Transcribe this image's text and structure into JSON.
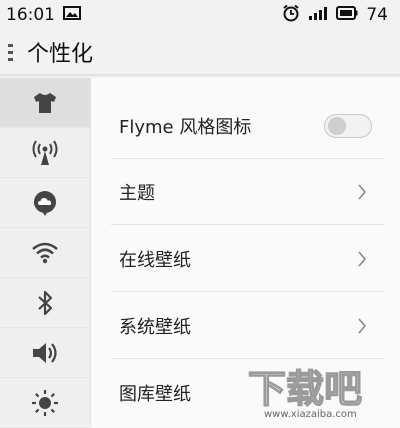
{
  "status_bar": {
    "time": "16:01",
    "battery": "74"
  },
  "app_bar": {
    "title": "个性化"
  },
  "sidebar": {
    "items": [
      {
        "icon": "tshirt-icon",
        "active": true
      },
      {
        "icon": "hotspot-icon",
        "active": false
      },
      {
        "icon": "cloud-icon",
        "active": false
      },
      {
        "icon": "wifi-icon",
        "active": false
      },
      {
        "icon": "bluetooth-icon",
        "active": false
      },
      {
        "icon": "volume-icon",
        "active": false
      },
      {
        "icon": "brightness-icon",
        "active": false
      }
    ]
  },
  "settings": {
    "flyme_icon_style": {
      "label": "Flyme 风格图标",
      "enabled": false
    },
    "theme": {
      "label": "主题"
    },
    "online_wallpaper": {
      "label": "在线壁纸"
    },
    "system_wallpaper": {
      "label": "系统壁纸"
    },
    "gallery_wallpaper": {
      "label": "图库壁纸"
    }
  },
  "watermark": {
    "text": "下载吧",
    "url": "www.xiazaiba.com"
  },
  "colors": {
    "accent": "#555555",
    "icon": "#444444"
  }
}
